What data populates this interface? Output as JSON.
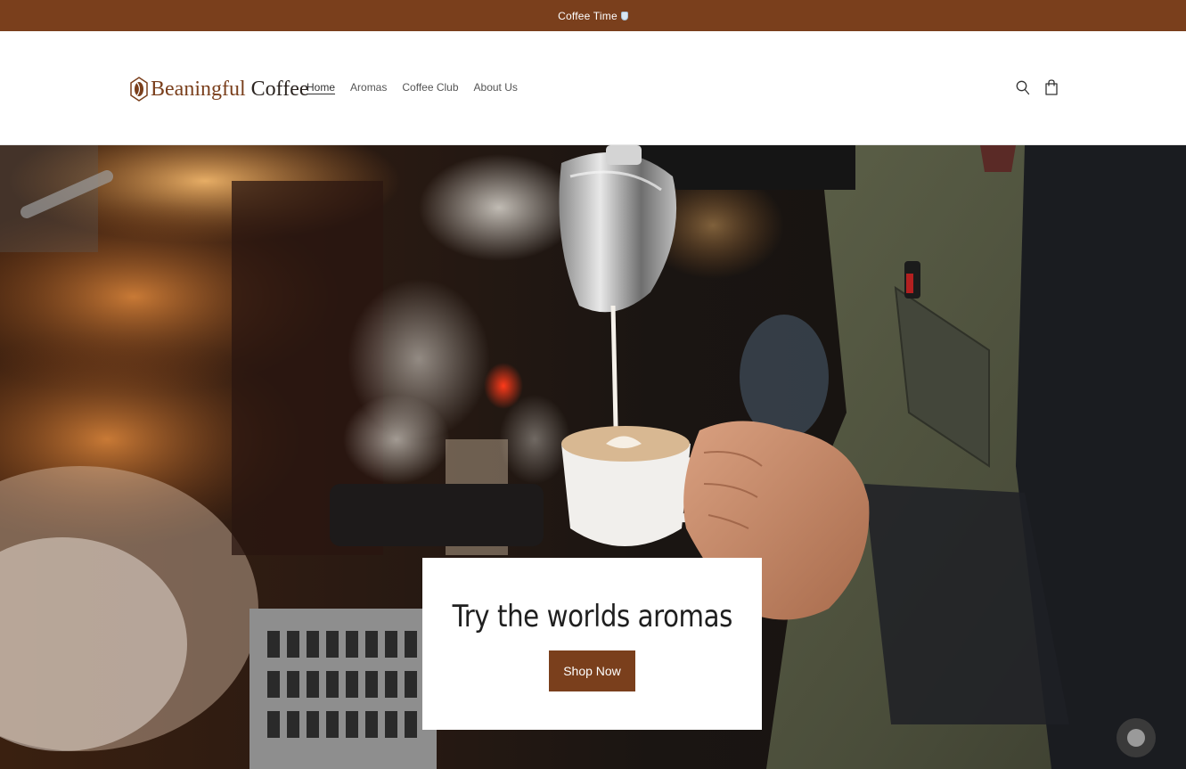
{
  "announcement": {
    "text": "Coffee Time",
    "icon": "coffee-cup-icon"
  },
  "header": {
    "logo": {
      "word1": "Beaningful",
      "word2": "Coffee",
      "icon": "coffee-bean-icon"
    },
    "nav": [
      {
        "label": "Home",
        "active": true
      },
      {
        "label": "Aromas",
        "active": false
      },
      {
        "label": "Coffee Club",
        "active": false
      },
      {
        "label": "About Us",
        "active": false
      }
    ],
    "icons": [
      "search-icon",
      "cart-icon"
    ]
  },
  "hero": {
    "image": "barista-pouring-milk-latte-art",
    "title": "Try the worlds aromas",
    "button_label": "Shop Now"
  },
  "colors": {
    "brand": "#7a3f1c",
    "text": "#333333",
    "background": "#ffffff"
  }
}
